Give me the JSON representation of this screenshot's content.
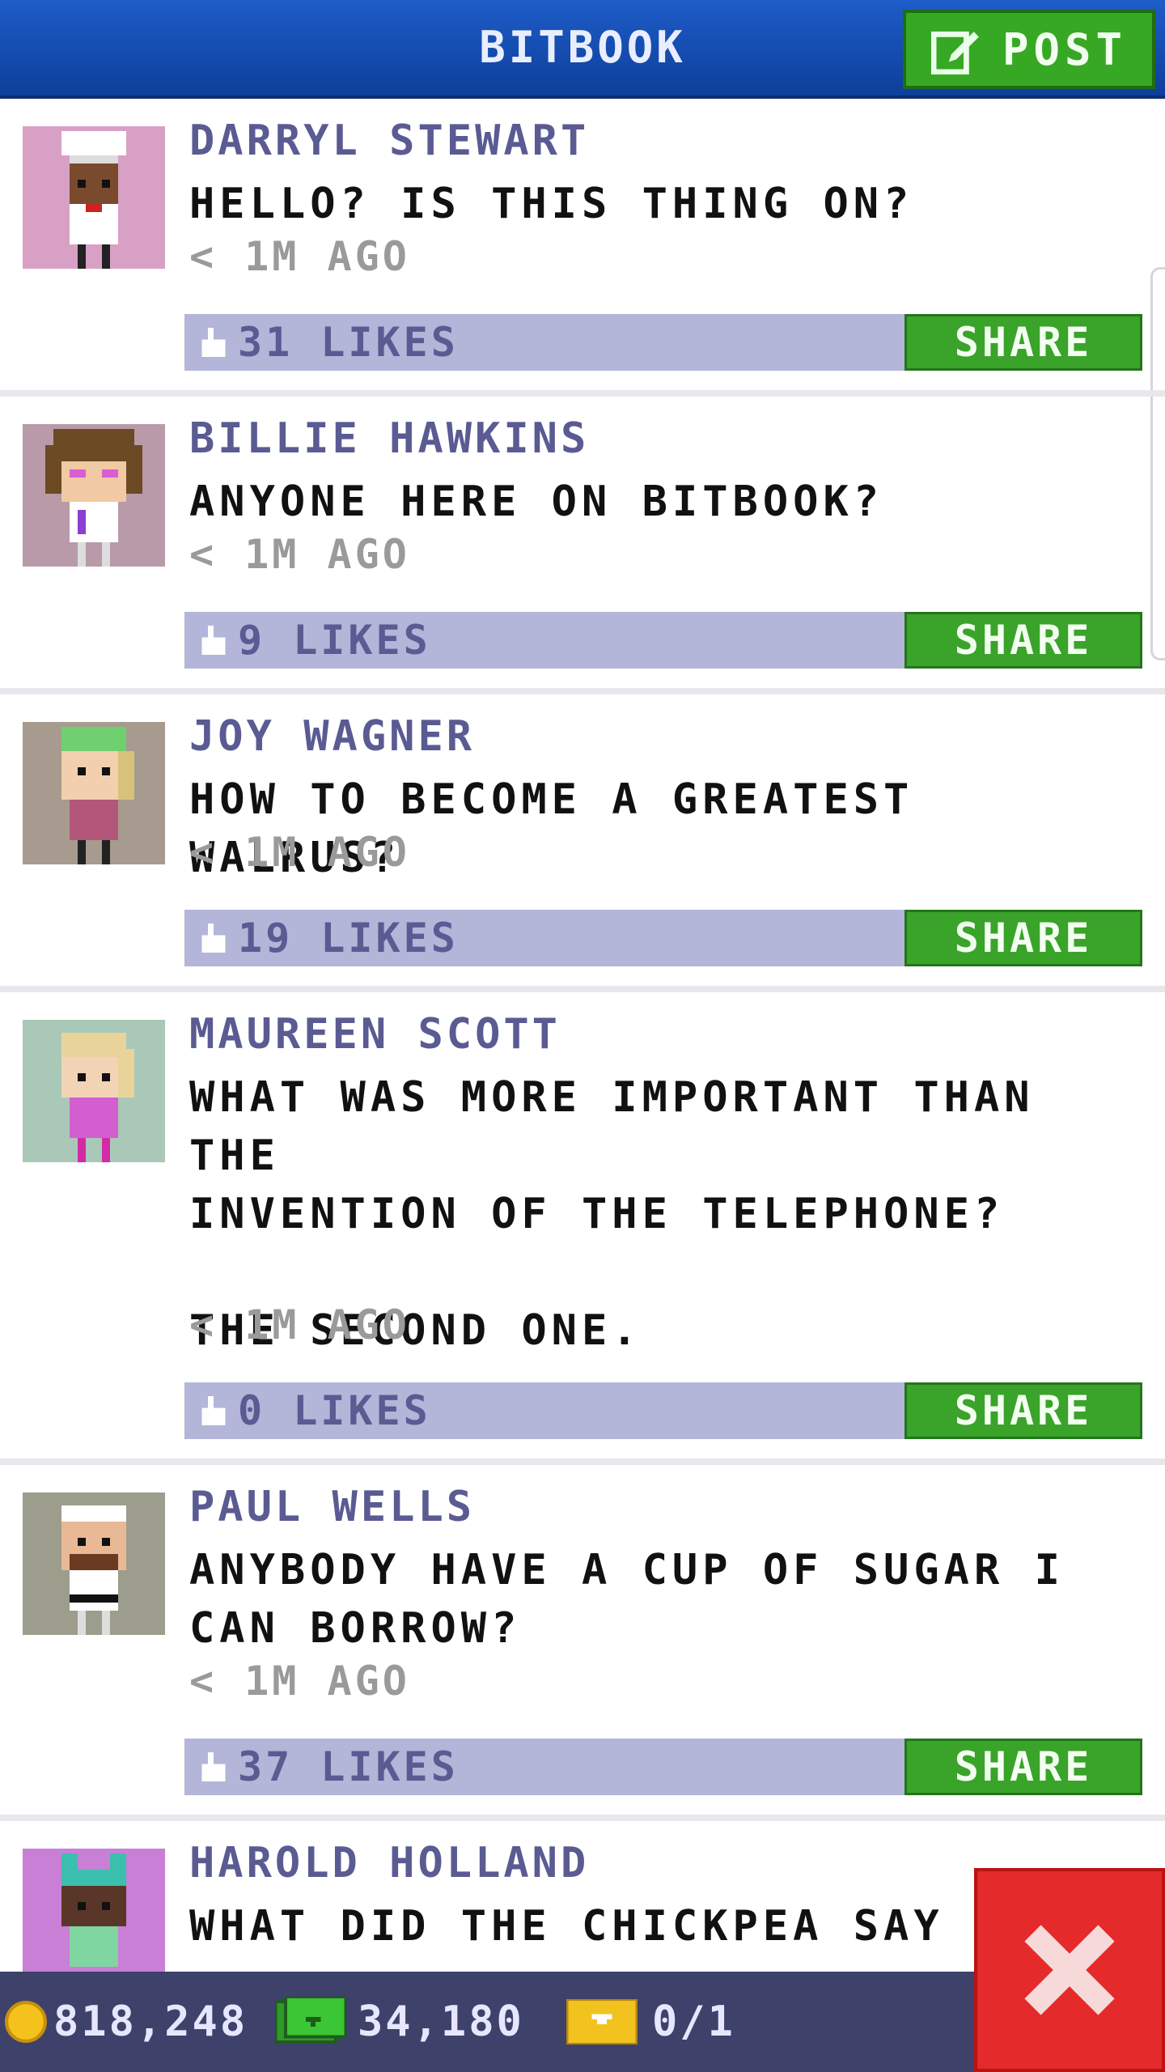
{
  "header": {
    "title": "BITBOOK",
    "post_label": "POST"
  },
  "posts": [
    {
      "name": "DARRYL STEWART",
      "text": "HELLO? IS THIS THING ON?",
      "time": "< 1M AGO",
      "likes": "31 LIKES",
      "share": "SHARE",
      "avatar_bg": "#d9a0c6"
    },
    {
      "name": "BILLIE HAWKINS",
      "text": "ANYONE HERE ON BITBOOK?",
      "time": "< 1M AGO",
      "likes": "9 LIKES",
      "share": "SHARE",
      "avatar_bg": "#b89aa8"
    },
    {
      "name": "JOY WAGNER",
      "text": "HOW TO BECOME A GREATEST WALRUS?",
      "time": "< 1M AGO",
      "likes": "19 LIKES",
      "share": "SHARE",
      "avatar_bg": "#a79a8f"
    },
    {
      "name": "MAUREEN SCOTT",
      "text": "WHAT WAS MORE IMPORTANT THAN THE\nINVENTION OF THE TELEPHONE?\n\nTHE SECOND ONE.",
      "time": "< 1M AGO",
      "likes": "0 LIKES",
      "share": "SHARE",
      "avatar_bg": "#aac8b8"
    },
    {
      "name": "PAUL WELLS",
      "text": "ANYBODY HAVE A CUP OF SUGAR I\nCAN BORROW?",
      "time": "< 1M AGO",
      "likes": "37 LIKES",
      "share": "SHARE",
      "avatar_bg": "#9c9d8c"
    },
    {
      "name": "HAROLD HOLLAND",
      "text": "WHAT DID THE CHICKPEA SAY WH",
      "avatar_bg": "#c97fd6"
    }
  ],
  "footer": {
    "coins": "818,248",
    "bux": "34,180",
    "tickets": "0/1"
  },
  "colors": {
    "header": "#1550b8",
    "accent_green": "#3aa32a",
    "like_bar": "#b3b5d9",
    "close": "#e42a2a"
  }
}
